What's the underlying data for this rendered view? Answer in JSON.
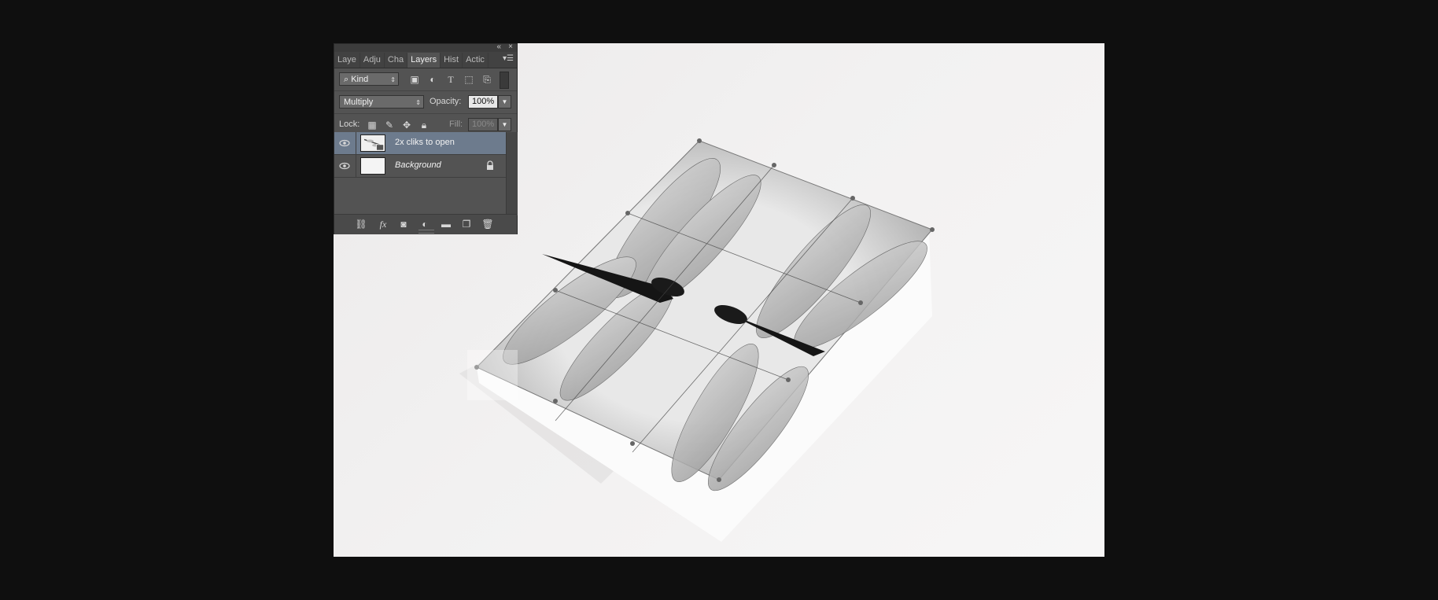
{
  "panel": {
    "tabs": [
      "Laye",
      "Adju",
      "Cha",
      "Layers",
      "Hist",
      "Actic"
    ],
    "active_tab": "Layers",
    "filter_kind": "Kind",
    "blend_mode": "Multiply",
    "opacity_label": "Opacity:",
    "opacity_value": "100%",
    "lock_label": "Lock:",
    "fill_label": "Fill:",
    "fill_value": "100%",
    "layers": [
      {
        "name": "2x cliks to open",
        "selected": true,
        "italic": false,
        "locked": false,
        "visible": true
      },
      {
        "name": "Background",
        "selected": false,
        "italic": true,
        "locked": true,
        "visible": true
      }
    ],
    "footer_fx": "fx"
  },
  "icons": {
    "search": "search-icon",
    "image_filter": "image-filter-icon",
    "adjustment_filter": "adjustment-filter-icon",
    "type_filter": "type-filter-icon",
    "shape_filter": "shape-filter-icon",
    "smart_object_filter": "smart-object-filter-icon",
    "link": "link-layers-icon",
    "mask": "add-mask-icon",
    "adjustment": "new-adjustment-icon",
    "group": "new-group-icon",
    "new_layer": "new-layer-icon",
    "delete": "delete-layer-icon"
  },
  "colors": {
    "panel_bg": "#535353",
    "selected_layer": "#6d7b8d",
    "app_bg": "#0f0f0f"
  }
}
